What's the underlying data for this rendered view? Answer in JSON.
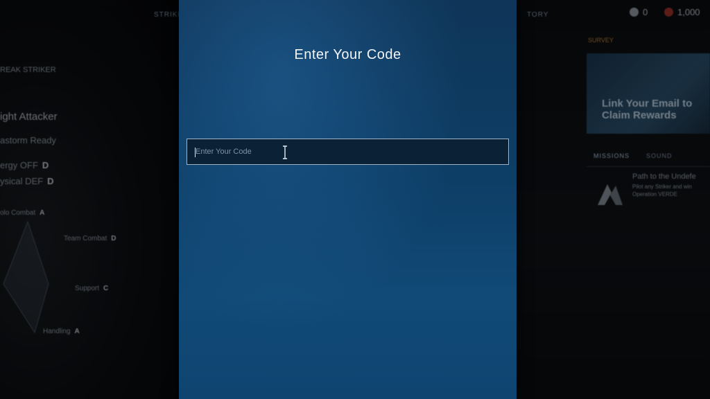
{
  "background": {
    "top_tabs": [
      "STRIKE",
      "TORY"
    ],
    "currency": [
      {
        "icon": "striker-coin-icon",
        "value": "0",
        "color": "#b8c2cc"
      },
      {
        "icon": "credits-coin-icon",
        "value": "1,000",
        "color": "#c0392b"
      }
    ],
    "striker": {
      "name_tag": "REAK STRIKER",
      "role": "ight Attacker",
      "status": "astorm Ready",
      "stats": [
        {
          "label": "ergy OFF",
          "grade": "D"
        },
        {
          "label": "ysical DEF",
          "grade": "D"
        }
      ],
      "radar": [
        {
          "label": "olo Combat",
          "grade": "A"
        },
        {
          "label": "Team Combat",
          "grade": "D"
        },
        {
          "label": "Support",
          "grade": "C"
        },
        {
          "label": "Handling",
          "grade": "A"
        }
      ]
    },
    "right_panel": {
      "survey_label": "SURVEY",
      "banner_title": "Link Your Email to Claim Rewards",
      "tabs": [
        "MISSIONS",
        "SOUND"
      ],
      "mission_title": "Path to the Undefe",
      "mission_desc_1": "Pilot any Striker and win",
      "mission_desc_2": "Operation VERDE"
    }
  },
  "modal": {
    "title": "Enter Your Code",
    "input": {
      "placeholder": "Enter Your Code",
      "value": ""
    }
  }
}
